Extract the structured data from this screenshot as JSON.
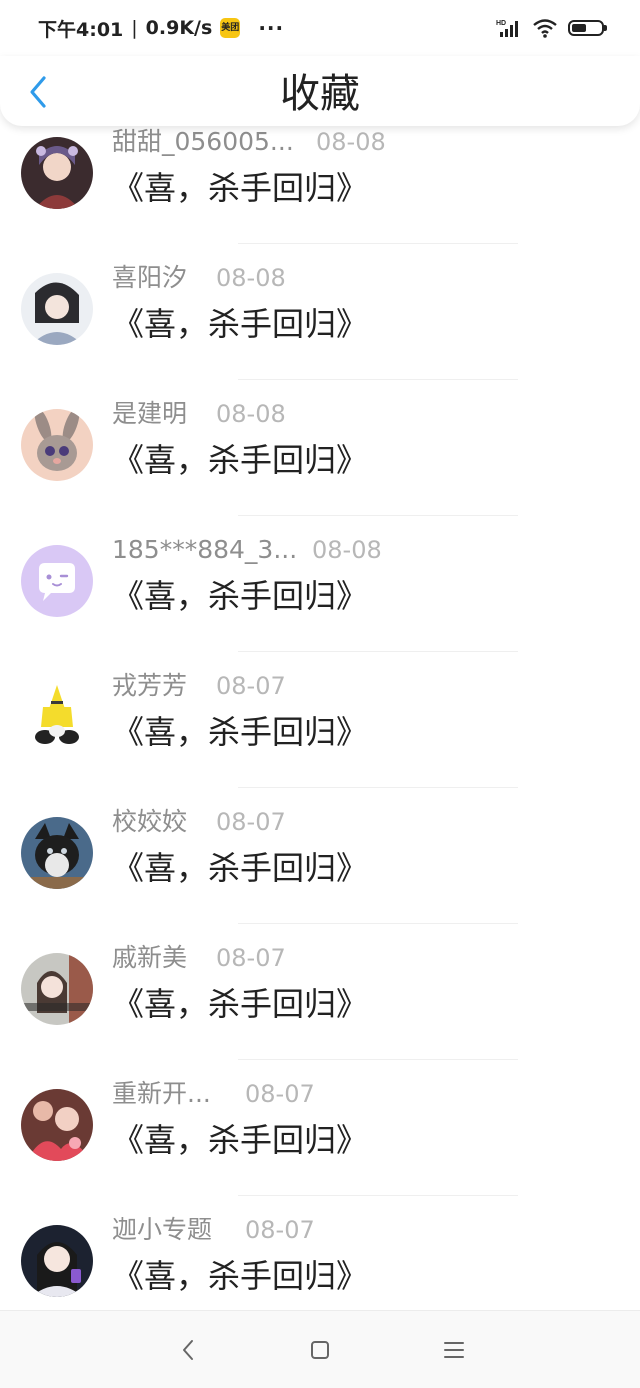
{
  "status_bar": {
    "time": "下午4:01",
    "speed": "0.9K/s",
    "app_badge": "美团",
    "more_dots": "···"
  },
  "header": {
    "title": "收藏"
  },
  "items": [
    {
      "name": "甜甜_056005...",
      "date": "08-08",
      "title": "《喜，杀手回归》"
    },
    {
      "name": "喜阳汐",
      "date": "08-08",
      "title": "《喜，杀手回归》"
    },
    {
      "name": "是建明",
      "date": "08-08",
      "title": "《喜，杀手回归》"
    },
    {
      "name": "185***884_3...",
      "date": "08-08",
      "title": "《喜，杀手回归》"
    },
    {
      "name": "戎芳芳",
      "date": "08-07",
      "title": "《喜，杀手回归》"
    },
    {
      "name": "校姣姣",
      "date": "08-07",
      "title": "《喜，杀手回归》"
    },
    {
      "name": "戚新美",
      "date": "08-07",
      "title": "《喜，杀手回归》"
    },
    {
      "name": "重新开...",
      "date": "08-07",
      "title": "《喜，杀手回归》"
    },
    {
      "name": "迦小专题",
      "date": "08-07",
      "title": "《喜，杀手回归》"
    }
  ],
  "colors": {
    "accent": "#2f9bea",
    "text_primary": "#222222",
    "text_secondary": "#8e8e8e",
    "text_date": "#b7b7b7"
  },
  "icons": {
    "back": "chevron-left-icon",
    "nav_back": "nav-back-icon",
    "nav_home": "nav-home-icon",
    "nav_menu": "nav-menu-icon"
  }
}
